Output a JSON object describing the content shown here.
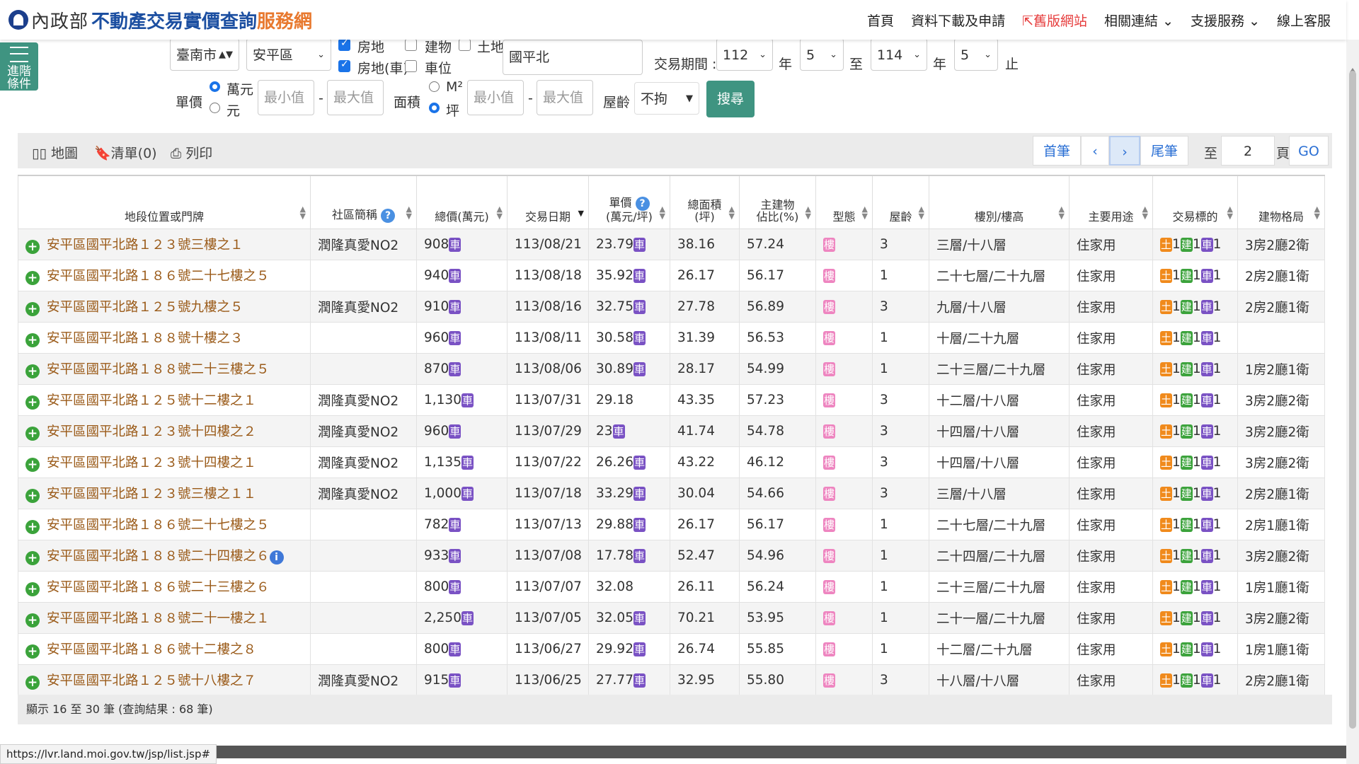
{
  "header": {
    "org": "內政部",
    "title": "不動產交易實價查詢",
    "subtitle": "服務網",
    "nav": {
      "home": "首頁",
      "download": "資料下載及申請",
      "old_site": "舊版網站",
      "links": "相關連結",
      "support": "支援服務",
      "service": "線上客服"
    }
  },
  "filters": {
    "advanced": [
      "進階",
      "條件"
    ],
    "city": "臺南市",
    "district": "安平區",
    "checks": {
      "house_land": "房地",
      "house_land_car": "房地(車)",
      "building": "建物",
      "parking": "車位",
      "land": "土地"
    },
    "keyword": "國平北",
    "period_label": "交易期間 :",
    "from_year": "112",
    "year_unit": "年",
    "from_month": "5",
    "to": "至",
    "to_year": "114",
    "to_month": "5",
    "end": "止",
    "unit_price_label": "單價",
    "unit_wan": "萬元",
    "unit_yuan": "元",
    "min_placeholder": "最小值",
    "max_placeholder": "最大值",
    "dash": "-",
    "area_label": "面積",
    "area_m2": "M²",
    "area_ping": "坪",
    "age_label": "屋齡",
    "age_value": "不拘",
    "search": "搜尋"
  },
  "toolbar": {
    "map": "地圖",
    "list": "清單(0)",
    "print": "列印",
    "first": "首筆",
    "prev": "‹",
    "next": "›",
    "last": "尾筆",
    "goto_label": "至",
    "goto_page": "2",
    "page_unit": "頁",
    "go": "GO"
  },
  "table": {
    "headers": {
      "address": "地段位置或門牌",
      "community": "社區簡稱",
      "total_price": "總價(萬元)",
      "date": "交易日期",
      "unit_price": [
        "單價",
        "(萬元/坪)"
      ],
      "total_area": [
        "總面積",
        "(坪)"
      ],
      "main_ratio": [
        "主建物",
        "佔比(%)"
      ],
      "type": "型態",
      "age": "屋齡",
      "floor": "樓別/樓高",
      "usage": "主要用途",
      "target": "交易標的",
      "layout": "建物格局"
    },
    "badges": {
      "car": "車",
      "lou": "樓",
      "land": "土",
      "bld": "建",
      "count": "1"
    },
    "rows": [
      {
        "address": "安平區國平北路１２３號三樓之１",
        "community": "潤隆真愛NO2",
        "total": "908",
        "total_car": true,
        "date": "113/08/21",
        "unit": "23.79",
        "unit_car": true,
        "area": "38.16",
        "ratio": "57.24",
        "age": "3",
        "floor": "三層/十八層",
        "usage": "住家用",
        "layout": "3房2廳2衛"
      },
      {
        "address": "安平區國平北路１８６號二十七樓之５",
        "community": "",
        "total": "940",
        "total_car": true,
        "date": "113/08/18",
        "unit": "35.92",
        "unit_car": true,
        "area": "26.17",
        "ratio": "56.17",
        "age": "1",
        "floor": "二十七層/二十九層",
        "usage": "住家用",
        "layout": "2房2廳1衛"
      },
      {
        "address": "安平區國平北路１２５號九樓之５",
        "community": "潤隆真愛NO2",
        "total": "910",
        "total_car": true,
        "date": "113/08/16",
        "unit": "32.75",
        "unit_car": true,
        "area": "27.78",
        "ratio": "56.89",
        "age": "3",
        "floor": "九層/十八層",
        "usage": "住家用",
        "layout": "2房2廳1衛"
      },
      {
        "address": "安平區國平北路１８８號十樓之３",
        "community": "",
        "total": "960",
        "total_car": true,
        "date": "113/08/11",
        "unit": "30.58",
        "unit_car": true,
        "area": "31.39",
        "ratio": "56.53",
        "age": "1",
        "floor": "十層/二十九層",
        "usage": "住家用",
        "layout": ""
      },
      {
        "address": "安平區國平北路１８８號二十三樓之５",
        "community": "",
        "total": "870",
        "total_car": true,
        "date": "113/08/06",
        "unit": "30.89",
        "unit_car": true,
        "area": "28.17",
        "ratio": "54.99",
        "age": "1",
        "floor": "二十三層/二十九層",
        "usage": "住家用",
        "layout": "1房2廳1衛"
      },
      {
        "address": "安平區國平北路１２５號十二樓之１",
        "community": "潤隆真愛NO2",
        "total": "1,130",
        "total_car": true,
        "date": "113/07/31",
        "unit": "29.18",
        "unit_car": false,
        "area": "43.35",
        "ratio": "57.23",
        "age": "3",
        "floor": "十二層/十八層",
        "usage": "住家用",
        "layout": "3房2廳2衛"
      },
      {
        "address": "安平區國平北路１２３號十四樓之２",
        "community": "潤隆真愛NO2",
        "total": "960",
        "total_car": true,
        "date": "113/07/29",
        "unit": "23",
        "unit_car": true,
        "area": "41.74",
        "ratio": "54.78",
        "age": "3",
        "floor": "十四層/十八層",
        "usage": "住家用",
        "layout": "3房2廳2衛"
      },
      {
        "address": "安平區國平北路１２３號十四樓之１",
        "community": "潤隆真愛NO2",
        "total": "1,135",
        "total_car": true,
        "date": "113/07/22",
        "unit": "26.26",
        "unit_car": true,
        "area": "43.22",
        "ratio": "46.12",
        "age": "3",
        "floor": "十四層/十八層",
        "usage": "住家用",
        "layout": "3房2廳2衛"
      },
      {
        "address": "安平區國平北路１２３號三樓之１１",
        "community": "潤隆真愛NO2",
        "total": "1,000",
        "total_car": true,
        "date": "113/07/18",
        "unit": "33.29",
        "unit_car": true,
        "area": "30.04",
        "ratio": "54.66",
        "age": "3",
        "floor": "三層/十八層",
        "usage": "住家用",
        "layout": "2房2廳1衛"
      },
      {
        "address": "安平區國平北路１８６號二十七樓之５",
        "community": "",
        "total": "782",
        "total_car": true,
        "date": "113/07/13",
        "unit": "29.88",
        "unit_car": true,
        "area": "26.17",
        "ratio": "56.17",
        "age": "1",
        "floor": "二十七層/二十九層",
        "usage": "住家用",
        "layout": "2房1廳1衛"
      },
      {
        "address": "安平區國平北路１８８號二十四樓之６",
        "community": "",
        "info": true,
        "total": "933",
        "total_car": true,
        "date": "113/07/08",
        "unit": "17.78",
        "unit_car": true,
        "area": "52.47",
        "ratio": "54.96",
        "age": "1",
        "floor": "二十四層/二十九層",
        "usage": "住家用",
        "layout": "3房2廳2衛"
      },
      {
        "address": "安平區國平北路１８６號二十三樓之６",
        "community": "",
        "total": "800",
        "total_car": true,
        "date": "113/07/07",
        "unit": "32.08",
        "unit_car": false,
        "area": "26.11",
        "ratio": "56.24",
        "age": "1",
        "floor": "二十三層/二十九層",
        "usage": "住家用",
        "layout": "1房1廳1衛"
      },
      {
        "address": "安平區國平北路１８８號二十一樓之１",
        "community": "",
        "total": "2,250",
        "total_car": true,
        "date": "113/07/05",
        "unit": "32.05",
        "unit_car": true,
        "area": "70.21",
        "ratio": "53.95",
        "age": "1",
        "floor": "二十一層/二十九層",
        "usage": "住家用",
        "layout": "3房2廳2衛"
      },
      {
        "address": "安平區國平北路１８６號十二樓之８",
        "community": "",
        "total": "800",
        "total_car": true,
        "date": "113/06/27",
        "unit": "29.92",
        "unit_car": true,
        "area": "26.74",
        "ratio": "55.85",
        "age": "1",
        "floor": "十二層/二十九層",
        "usage": "住家用",
        "layout": "1房1廳1衛"
      },
      {
        "address": "安平區國平北路１２５號十八樓之７",
        "community": "潤隆真愛NO2",
        "total": "915",
        "total_car": true,
        "date": "113/06/25",
        "unit": "27.77",
        "unit_car": true,
        "area": "32.95",
        "ratio": "55.80",
        "age": "3",
        "floor": "十八層/十八層",
        "usage": "住家用",
        "layout": "2房2廳1衛"
      }
    ]
  },
  "footer": {
    "summary": "顯示 16 至 30 筆 (查詢結果 : 68 筆)"
  },
  "status_url": "https://lvr.land.moi.gov.tw/jsp/list.jsp#"
}
